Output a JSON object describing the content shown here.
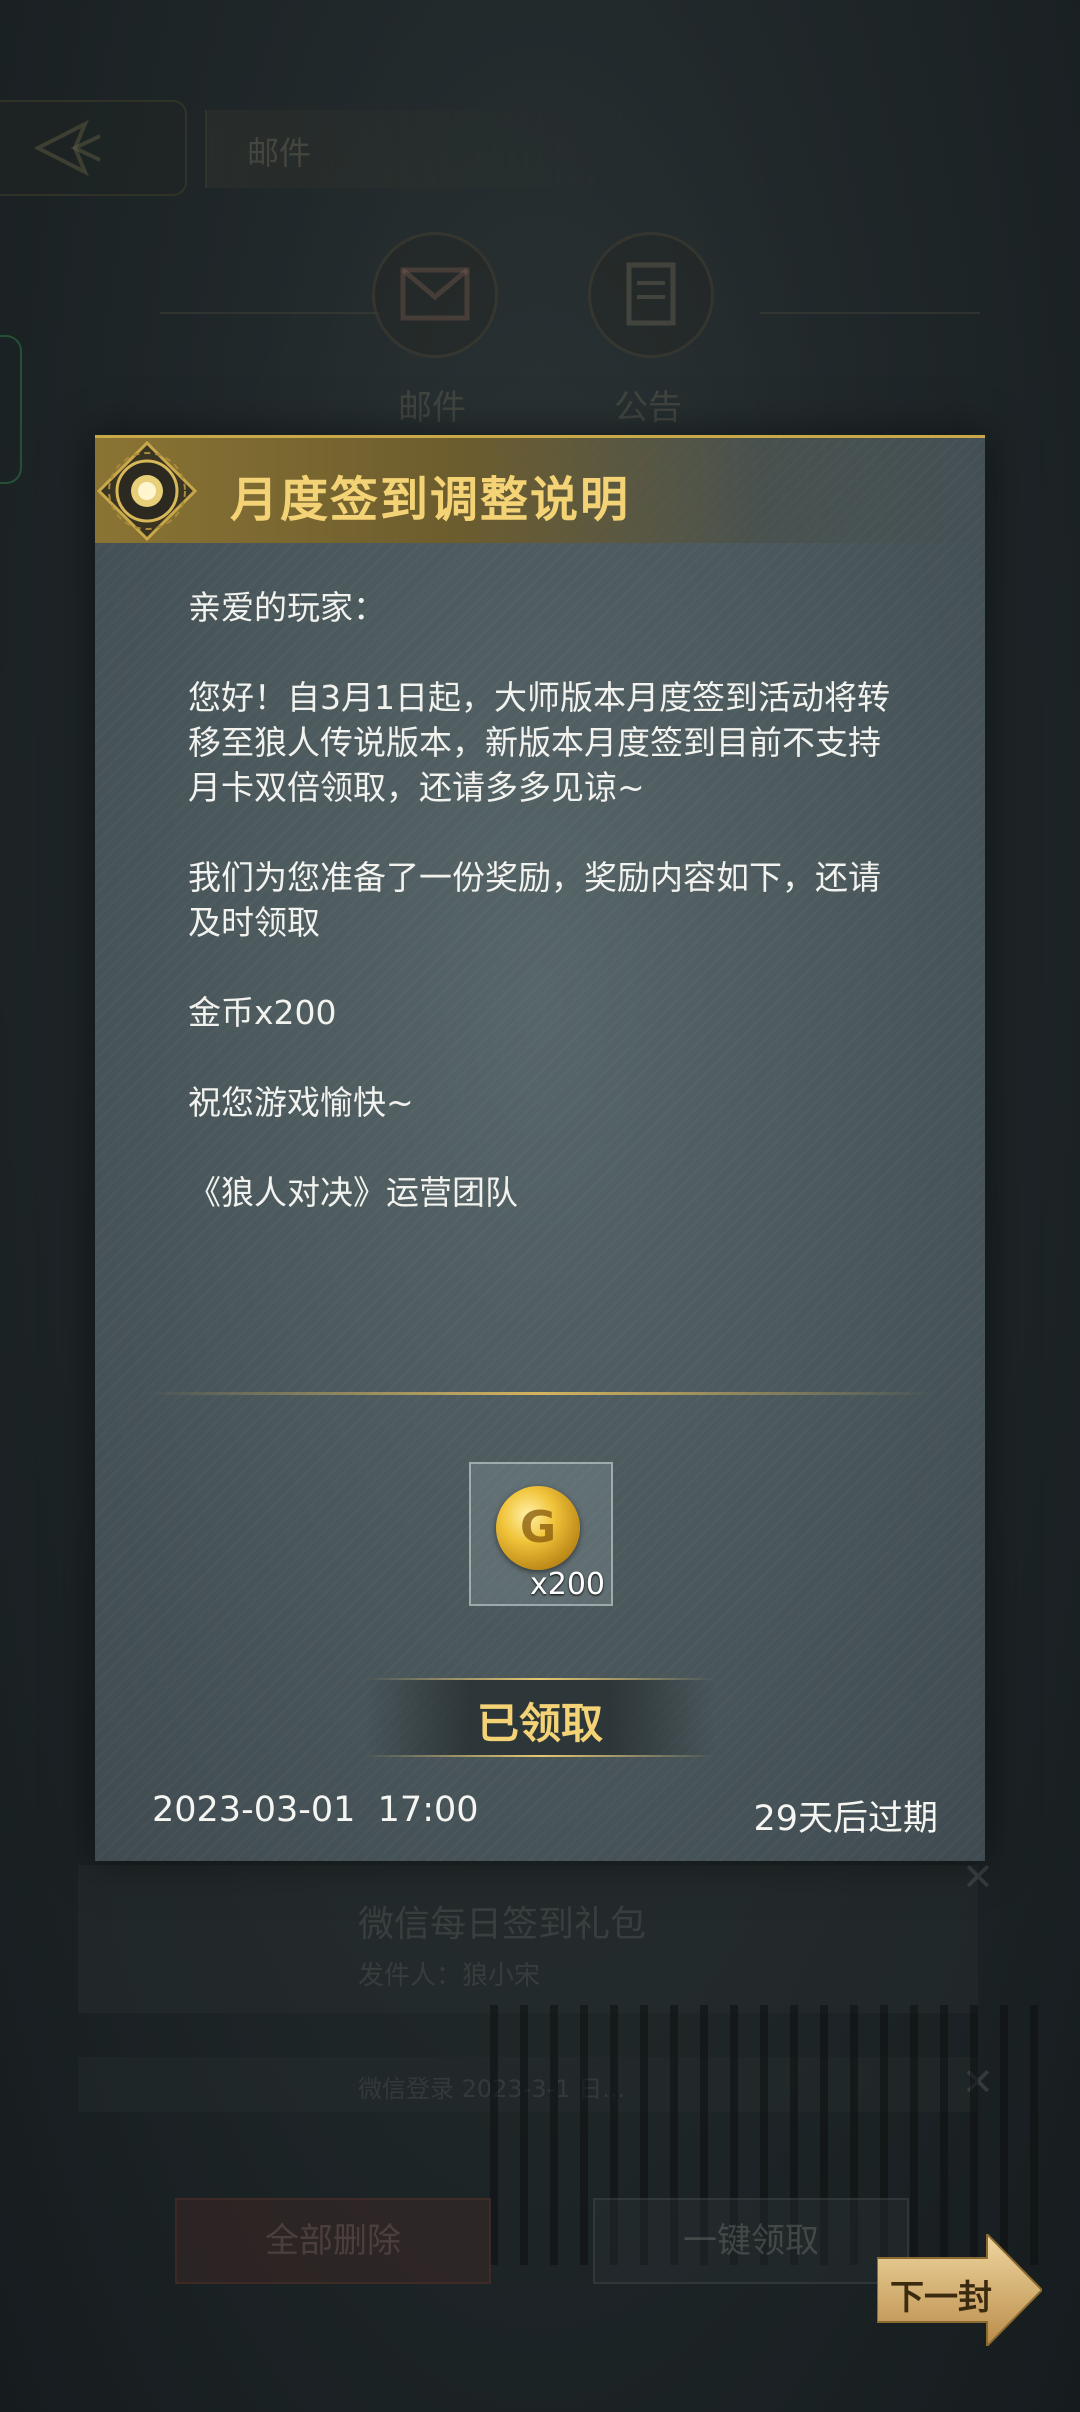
{
  "background": {
    "header_title": "邮件",
    "tabs": [
      {
        "label": "邮件"
      },
      {
        "label": "公告"
      }
    ],
    "list_item": {
      "title": "微信每日签到礼包",
      "sender": "发件人：狼小宋",
      "meta": "微信登录 2023-3-1 日..."
    },
    "buttons": {
      "delete_all": "全部删除",
      "claim_all": "一键领取"
    }
  },
  "modal": {
    "title": "月度签到调整说明",
    "greeting": "亲爱的玩家：",
    "paragraph1": "您好！自3月1日起，大师版本月度签到活动将转移至狼人传说版本，新版本月度签到目前不支持月卡双倍领取，还请多多见谅~",
    "paragraph2": "我们为您准备了一份奖励，奖励内容如下，还请及时领取",
    "reward_line": "金币x200",
    "closing": "祝您游戏愉快~",
    "signature": "《狼人对决》运营团队",
    "reward": {
      "icon": "gold-coin-icon",
      "quantity": "x200"
    },
    "status_label": "已领取",
    "date": "2023-03-01  17:00",
    "expiry": "29天后过期"
  },
  "next_button": {
    "label": "下一封"
  },
  "colors": {
    "title_gold": "#f3d375",
    "header_gold": "#8a7434",
    "modal_bg": "#455156"
  }
}
